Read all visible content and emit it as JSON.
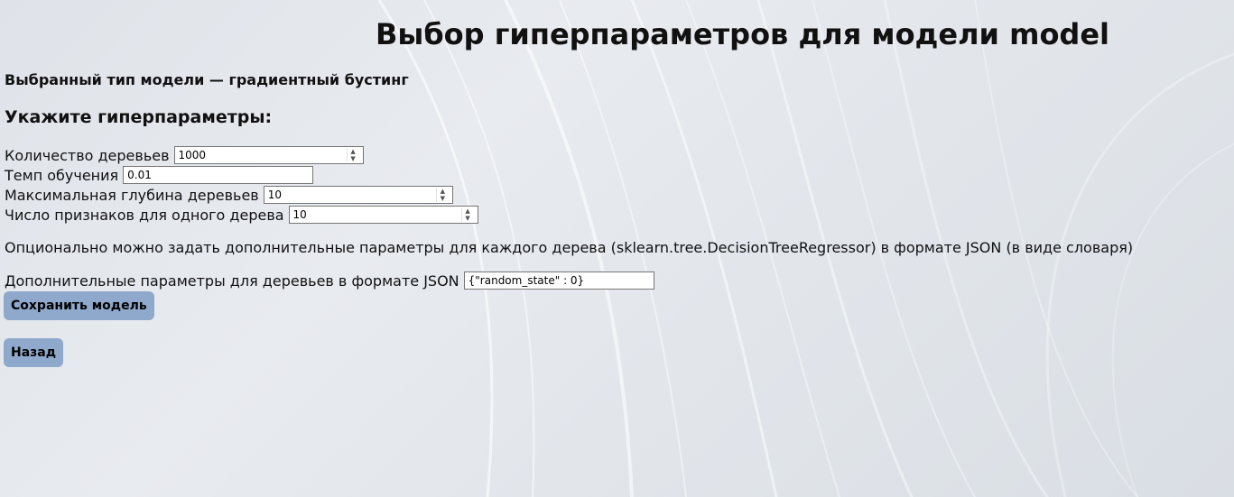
{
  "page": {
    "title": "Выбор гиперпараметров для модели model",
    "model_type": "Выбранный тип модели — градиентный бустинг",
    "section_title": "Укажите гиперпараметры:"
  },
  "form": {
    "fields": [
      {
        "label": "Количество деревьев",
        "value": "1000",
        "type": "number"
      },
      {
        "label": "Темп обучения",
        "value": "0.01",
        "type": "text"
      },
      {
        "label": "Максимальная глубина деревьев",
        "value": "10",
        "type": "number"
      },
      {
        "label": "Число признаков для одного дерева",
        "value": "10",
        "type": "number"
      }
    ],
    "hint": "Опционально можно задать дополнительные параметры для каждого дерева (sklearn.tree.DecisionTreeRegressor) в формате JSON (в виде словаря)",
    "json_field": {
      "label": "Дополнительные параметры для деревьев в формате JSON",
      "value": "{\"random_state\" : 0}"
    },
    "save_label": "Сохранить модель",
    "back_label": "Назад"
  },
  "colors": {
    "button_bg": "#8fa9cc",
    "background": "#e2e6eb"
  },
  "icons": {
    "spinner": "spinner-arrows-icon"
  }
}
